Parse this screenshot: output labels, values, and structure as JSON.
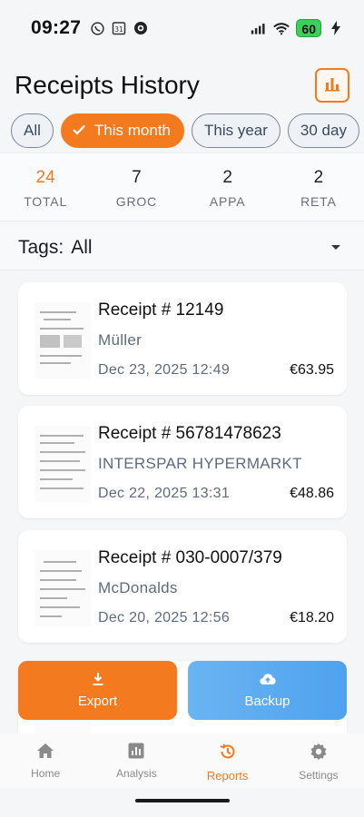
{
  "status": {
    "time": "09:27",
    "battery": "60",
    "icons": [
      "viber-icon",
      "calendar-icon",
      "location-icon",
      "signal-icon",
      "wifi-icon",
      "battery-icon"
    ]
  },
  "header": {
    "title": "Receipts History",
    "analytics_icon": "bar-chart-icon"
  },
  "filters": [
    {
      "label": "All",
      "active": false
    },
    {
      "label": "This month",
      "active": true
    },
    {
      "label": "This year",
      "active": false
    },
    {
      "label": "30 day",
      "active": false
    }
  ],
  "stats": [
    {
      "value": "24",
      "label": "TOTAL"
    },
    {
      "value": "7",
      "label": "GROC"
    },
    {
      "value": "2",
      "label": "APPA"
    },
    {
      "value": "2",
      "label": "RETA"
    }
  ],
  "tags": {
    "label": "Tags:",
    "value": "All"
  },
  "receipts": [
    {
      "title": "Receipt # 12149",
      "store": "Müller",
      "date": "Dec 23, 2025 12:49",
      "amount": "€63.95"
    },
    {
      "title": "Receipt # 56781478623",
      "store": "INTERSPAR HYPERMARKT",
      "date": "Dec 22, 2025 13:31",
      "amount": "€48.86"
    },
    {
      "title": "Receipt # 030-0007/379",
      "store": "McDonalds",
      "date": "Dec 20, 2025 12:56",
      "amount": "€18.20"
    }
  ],
  "actions": {
    "export": "Export",
    "backup": "Backup"
  },
  "nav": [
    {
      "label": "Home",
      "icon": "home-icon"
    },
    {
      "label": "Analysis",
      "icon": "analysis-icon"
    },
    {
      "label": "Reports",
      "icon": "history-icon"
    },
    {
      "label": "Settings",
      "icon": "gear-icon"
    }
  ],
  "colors": {
    "accent": "#f47a1f",
    "backup": "#5aa9f0"
  }
}
